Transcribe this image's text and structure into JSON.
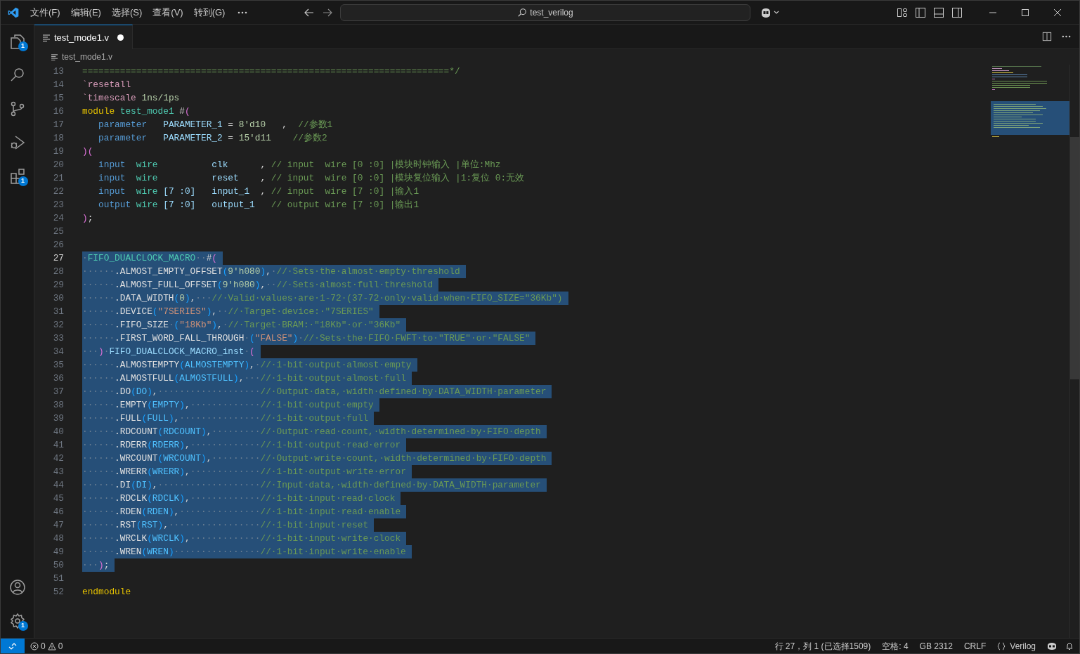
{
  "title_bar": {
    "menus": [
      "文件(F)",
      "编辑(E)",
      "选择(S)",
      "查看(V)",
      "转到(G)"
    ],
    "search": "test_verilog"
  },
  "activity_bar": {
    "top": [
      {
        "kind": "explorer",
        "badge": "1"
      },
      {
        "kind": "search"
      },
      {
        "kind": "source_control"
      },
      {
        "kind": "run_debug"
      },
      {
        "kind": "extensions",
        "badge": "1"
      }
    ],
    "bottom": [
      {
        "kind": "account"
      },
      {
        "kind": "settings",
        "badge": "1"
      }
    ]
  },
  "tab": {
    "label": "test_mode1.v",
    "selected": true,
    "modified": true
  },
  "breadcrumb": "test_mode1.v",
  "lines": [
    {
      "number": "13",
      "highlighted": false,
      "current": false,
      "tokens": [
        {
          "kind": "comment",
          "text": "====================================================================*/"
        }
      ]
    },
    {
      "number": "14",
      "highlighted": false,
      "current": false,
      "tokens": [
        {
          "kind": "directive",
          "text": "`resetall"
        }
      ]
    },
    {
      "number": "15",
      "highlighted": false,
      "current": false,
      "tokens": [
        {
          "kind": "directive",
          "text": "`timescale "
        },
        {
          "kind": "number",
          "text": "1ns/1ps"
        }
      ]
    },
    {
      "number": "16",
      "highlighted": false,
      "current": false,
      "tokens": [
        {
          "kind": "control",
          "text": "module "
        },
        {
          "kind": "module_name",
          "text": "test_mode1"
        },
        {
          "kind": "plain",
          "text": " #"
        },
        {
          "kind": "bracket_outer",
          "text": "("
        }
      ]
    },
    {
      "number": "17",
      "highlighted": false,
      "current": false,
      "tokens": [
        {
          "kind": "keyword",
          "text": "   parameter   "
        },
        {
          "kind": "ident",
          "text": "PARAMETER_1"
        },
        {
          "kind": "plain",
          "text": " = "
        },
        {
          "kind": "number",
          "text": "8'd10"
        },
        {
          "kind": "plain",
          "text": "   ,  "
        },
        {
          "kind": "comment",
          "text": "//参数1"
        }
      ]
    },
    {
      "number": "18",
      "highlighted": false,
      "current": false,
      "tokens": [
        {
          "kind": "keyword",
          "text": "   parameter   "
        },
        {
          "kind": "ident",
          "text": "PARAMETER_2"
        },
        {
          "kind": "plain",
          "text": " = "
        },
        {
          "kind": "number",
          "text": "15'd11    "
        },
        {
          "kind": "comment",
          "text": "//参数2"
        }
      ]
    },
    {
      "number": "19",
      "highlighted": false,
      "current": false,
      "tokens": [
        {
          "kind": "bracket_outer",
          "text": ")("
        }
      ]
    },
    {
      "number": "20",
      "highlighted": false,
      "current": false,
      "tokens": [
        {
          "kind": "keyword",
          "text": "   input  "
        },
        {
          "kind": "type",
          "text": "wire          "
        },
        {
          "kind": "ident",
          "text": "clk"
        },
        {
          "kind": "plain",
          "text": "      , "
        },
        {
          "kind": "comment",
          "text": "// input  wire [0 :0] |模块时钟输入 |单位:Mhz"
        }
      ]
    },
    {
      "number": "21",
      "highlighted": false,
      "current": false,
      "tokens": [
        {
          "kind": "keyword",
          "text": "   input  "
        },
        {
          "kind": "type",
          "text": "wire          "
        },
        {
          "kind": "ident",
          "text": "reset"
        },
        {
          "kind": "plain",
          "text": "    , "
        },
        {
          "kind": "comment",
          "text": "// input  wire [0 :0] |模块复位输入 |1:复位 0:无效"
        }
      ]
    },
    {
      "number": "22",
      "highlighted": false,
      "current": false,
      "tokens": [
        {
          "kind": "keyword",
          "text": "   input  "
        },
        {
          "kind": "type",
          "text": "wire "
        },
        {
          "kind": "ident",
          "text": "[7 :0]   "
        },
        {
          "kind": "ident",
          "text": "input_1"
        },
        {
          "kind": "plain",
          "text": "  , "
        },
        {
          "kind": "comment",
          "text": "// input  wire [7 :0] |输入1"
        }
      ]
    },
    {
      "number": "23",
      "highlighted": false,
      "current": false,
      "tokens": [
        {
          "kind": "keyword",
          "text": "   output "
        },
        {
          "kind": "type",
          "text": "wire "
        },
        {
          "kind": "ident",
          "text": "[7 :0]   "
        },
        {
          "kind": "ident",
          "text": "output_1   "
        },
        {
          "kind": "comment",
          "text": "// output wire [7 :0] |输出1"
        }
      ]
    },
    {
      "number": "24",
      "highlighted": false,
      "current": false,
      "tokens": [
        {
          "kind": "bracket_outer",
          "text": ")"
        },
        {
          "kind": "plain",
          "text": ";"
        }
      ]
    },
    {
      "number": "25",
      "highlighted": false,
      "current": false
    },
    {
      "number": "26",
      "highlighted": false,
      "current": false
    },
    {
      "number": "27",
      "highlighted": true,
      "current": true,
      "tokens": [
        {
          "kind": "ws",
          "text": "·"
        },
        {
          "kind": "module_name",
          "text": "FIFO_DUALCLOCK_MACRO"
        },
        {
          "kind": "ws",
          "text": "··"
        },
        {
          "kind": "plain",
          "text": "#"
        },
        {
          "kind": "bracket_outer",
          "text": "("
        }
      ]
    },
    {
      "number": "28",
      "highlighted": true,
      "current": false,
      "tokens": [
        {
          "kind": "ws",
          "text": "······"
        },
        {
          "kind": "port",
          "text": ".ALMOST_EMPTY_OFFSET"
        },
        {
          "kind": "bracket_inner",
          "text": "("
        },
        {
          "kind": "number",
          "text": "9'h080"
        },
        {
          "kind": "bracket_inner",
          "text": ")"
        },
        {
          "kind": "plain",
          "text": ","
        },
        {
          "kind": "ws",
          "text": "·"
        },
        {
          "kind": "comment",
          "text": "//·Sets·the·almost·empty·threshold"
        }
      ]
    },
    {
      "number": "29",
      "highlighted": true,
      "current": false,
      "tokens": [
        {
          "kind": "ws",
          "text": "······"
        },
        {
          "kind": "port",
          "text": ".ALMOST_FULL_OFFSET"
        },
        {
          "kind": "bracket_inner",
          "text": "("
        },
        {
          "kind": "number",
          "text": "9'h080"
        },
        {
          "kind": "bracket_inner",
          "text": ")"
        },
        {
          "kind": "plain",
          "text": ","
        },
        {
          "kind": "ws",
          "text": "··"
        },
        {
          "kind": "comment",
          "text": "//·Sets·almost·full·threshold"
        }
      ]
    },
    {
      "number": "30",
      "highlighted": true,
      "current": false,
      "tokens": [
        {
          "kind": "ws",
          "text": "······"
        },
        {
          "kind": "port",
          "text": ".DATA_WIDTH"
        },
        {
          "kind": "bracket_inner",
          "text": "("
        },
        {
          "kind": "number",
          "text": "0"
        },
        {
          "kind": "bracket_inner",
          "text": ")"
        },
        {
          "kind": "plain",
          "text": ","
        },
        {
          "kind": "ws",
          "text": "···"
        },
        {
          "kind": "comment",
          "text": "//·Valid·values·are·1-72·(37-72·only·valid·when·FIFO_SIZE=\"36Kb\")"
        }
      ]
    },
    {
      "number": "31",
      "highlighted": true,
      "current": false,
      "tokens": [
        {
          "kind": "ws",
          "text": "······"
        },
        {
          "kind": "port",
          "text": ".DEVICE"
        },
        {
          "kind": "bracket_inner",
          "text": "("
        },
        {
          "kind": "string",
          "text": "\"7SERIES\""
        },
        {
          "kind": "bracket_inner",
          "text": ")"
        },
        {
          "kind": "plain",
          "text": ","
        },
        {
          "kind": "ws",
          "text": "··"
        },
        {
          "kind": "comment",
          "text": "//·Target·device:·\"7SERIES\""
        }
      ]
    },
    {
      "number": "32",
      "highlighted": true,
      "current": false,
      "tokens": [
        {
          "kind": "ws",
          "text": "······"
        },
        {
          "kind": "port",
          "text": ".FIFO_SIZE"
        },
        {
          "kind": "ws",
          "text": "·"
        },
        {
          "kind": "bracket_inner",
          "text": "("
        },
        {
          "kind": "string",
          "text": "\"18Kb\""
        },
        {
          "kind": "bracket_inner",
          "text": ")"
        },
        {
          "kind": "plain",
          "text": ","
        },
        {
          "kind": "ws",
          "text": "·"
        },
        {
          "kind": "comment",
          "text": "//·Target·BRAM:·\"18Kb\"·or·\"36Kb\""
        }
      ]
    },
    {
      "number": "33",
      "highlighted": true,
      "current": false,
      "tokens": [
        {
          "kind": "ws",
          "text": "······"
        },
        {
          "kind": "port",
          "text": ".FIRST_WORD_FALL_THROUGH"
        },
        {
          "kind": "ws",
          "text": "·"
        },
        {
          "kind": "bracket_inner",
          "text": "("
        },
        {
          "kind": "string",
          "text": "\"FALSE\""
        },
        {
          "kind": "bracket_inner",
          "text": ")"
        },
        {
          "kind": "ws",
          "text": "·"
        },
        {
          "kind": "comment",
          "text": "//·Sets·the·FIFO·FWFT·to·\"TRUE\"·or·\"FALSE\""
        }
      ]
    },
    {
      "number": "34",
      "highlighted": true,
      "current": false,
      "tokens": [
        {
          "kind": "ws",
          "text": "···"
        },
        {
          "kind": "bracket_outer",
          "text": ")"
        },
        {
          "kind": "ws",
          "text": "·"
        },
        {
          "kind": "ident",
          "text": "FIFO_DUALCLOCK_MACRO_inst"
        },
        {
          "kind": "ws",
          "text": "·"
        },
        {
          "kind": "bracket_outer",
          "text": "("
        }
      ]
    },
    {
      "number": "35",
      "highlighted": true,
      "current": false,
      "tokens": [
        {
          "kind": "ws",
          "text": "······"
        },
        {
          "kind": "port",
          "text": ".ALMOSTEMPTY"
        },
        {
          "kind": "bracket_inner",
          "text": "("
        },
        {
          "kind": "signal",
          "text": "ALMOSTEMPTY"
        },
        {
          "kind": "bracket_inner",
          "text": ")"
        },
        {
          "kind": "plain",
          "text": ","
        },
        {
          "kind": "ws",
          "text": "·"
        },
        {
          "kind": "comment",
          "text": "//·1-bit·output·almost·empty"
        }
      ]
    },
    {
      "number": "36",
      "highlighted": true,
      "current": false,
      "tokens": [
        {
          "kind": "ws",
          "text": "······"
        },
        {
          "kind": "port",
          "text": ".ALMOSTFULL"
        },
        {
          "kind": "bracket_inner",
          "text": "("
        },
        {
          "kind": "signal",
          "text": "ALMOSTFULL"
        },
        {
          "kind": "bracket_inner",
          "text": ")"
        },
        {
          "kind": "plain",
          "text": ","
        },
        {
          "kind": "ws",
          "text": "···"
        },
        {
          "kind": "comment",
          "text": "//·1-bit·output·almost·full"
        }
      ]
    },
    {
      "number": "37",
      "highlighted": true,
      "current": false,
      "tokens": [
        {
          "kind": "ws",
          "text": "······"
        },
        {
          "kind": "port",
          "text": ".DO"
        },
        {
          "kind": "bracket_inner",
          "text": "("
        },
        {
          "kind": "signal",
          "text": "DO"
        },
        {
          "kind": "bracket_inner",
          "text": ")"
        },
        {
          "kind": "plain",
          "text": ","
        },
        {
          "kind": "ws",
          "text": "···················"
        },
        {
          "kind": "comment",
          "text": "//·Output·data,·width·defined·by·DATA_WIDTH·parameter"
        }
      ]
    },
    {
      "number": "38",
      "highlighted": true,
      "current": false,
      "tokens": [
        {
          "kind": "ws",
          "text": "······"
        },
        {
          "kind": "port",
          "text": ".EMPTY"
        },
        {
          "kind": "bracket_inner",
          "text": "("
        },
        {
          "kind": "signal",
          "text": "EMPTY"
        },
        {
          "kind": "bracket_inner",
          "text": ")"
        },
        {
          "kind": "plain",
          "text": ","
        },
        {
          "kind": "ws",
          "text": "·············"
        },
        {
          "kind": "comment",
          "text": "//·1-bit·output·empty"
        }
      ]
    },
    {
      "number": "39",
      "highlighted": true,
      "current": false,
      "tokens": [
        {
          "kind": "ws",
          "text": "······"
        },
        {
          "kind": "port",
          "text": ".FULL"
        },
        {
          "kind": "bracket_inner",
          "text": "("
        },
        {
          "kind": "signal",
          "text": "FULL"
        },
        {
          "kind": "bracket_inner",
          "text": ")"
        },
        {
          "kind": "plain",
          "text": ","
        },
        {
          "kind": "ws",
          "text": "···············"
        },
        {
          "kind": "comment",
          "text": "//·1-bit·output·full"
        }
      ]
    },
    {
      "number": "40",
      "highlighted": true,
      "current": false,
      "tokens": [
        {
          "kind": "ws",
          "text": "······"
        },
        {
          "kind": "port",
          "text": ".RDCOUNT"
        },
        {
          "kind": "bracket_inner",
          "text": "("
        },
        {
          "kind": "signal",
          "text": "RDCOUNT"
        },
        {
          "kind": "bracket_inner",
          "text": ")"
        },
        {
          "kind": "plain",
          "text": ","
        },
        {
          "kind": "ws",
          "text": "·········"
        },
        {
          "kind": "comment",
          "text": "//·Output·read·count,·width·determined·by·FIFO·depth"
        }
      ]
    },
    {
      "number": "41",
      "highlighted": true,
      "current": false,
      "tokens": [
        {
          "kind": "ws",
          "text": "······"
        },
        {
          "kind": "port",
          "text": ".RDERR"
        },
        {
          "kind": "bracket_inner",
          "text": "("
        },
        {
          "kind": "signal",
          "text": "RDERR"
        },
        {
          "kind": "bracket_inner",
          "text": ")"
        },
        {
          "kind": "plain",
          "text": ","
        },
        {
          "kind": "ws",
          "text": "·············"
        },
        {
          "kind": "comment",
          "text": "//·1-bit·output·read·error"
        }
      ]
    },
    {
      "number": "42",
      "highlighted": true,
      "current": false,
      "tokens": [
        {
          "kind": "ws",
          "text": "······"
        },
        {
          "kind": "port",
          "text": ".WRCOUNT"
        },
        {
          "kind": "bracket_inner",
          "text": "("
        },
        {
          "kind": "signal",
          "text": "WRCOUNT"
        },
        {
          "kind": "bracket_inner",
          "text": ")"
        },
        {
          "kind": "plain",
          "text": ","
        },
        {
          "kind": "ws",
          "text": "·········"
        },
        {
          "kind": "comment",
          "text": "//·Output·write·count,·width·determined·by·FIFO·depth"
        }
      ]
    },
    {
      "number": "43",
      "highlighted": true,
      "current": false,
      "tokens": [
        {
          "kind": "ws",
          "text": "······"
        },
        {
          "kind": "port",
          "text": ".WRERR"
        },
        {
          "kind": "bracket_inner",
          "text": "("
        },
        {
          "kind": "signal",
          "text": "WRERR"
        },
        {
          "kind": "bracket_inner",
          "text": ")"
        },
        {
          "kind": "plain",
          "text": ","
        },
        {
          "kind": "ws",
          "text": "·············"
        },
        {
          "kind": "comment",
          "text": "//·1-bit·output·write·error"
        }
      ]
    },
    {
      "number": "44",
      "highlighted": true,
      "current": false,
      "tokens": [
        {
          "kind": "ws",
          "text": "······"
        },
        {
          "kind": "port",
          "text": ".DI"
        },
        {
          "kind": "bracket_inner",
          "text": "("
        },
        {
          "kind": "signal",
          "text": "DI"
        },
        {
          "kind": "bracket_inner",
          "text": ")"
        },
        {
          "kind": "plain",
          "text": ","
        },
        {
          "kind": "ws",
          "text": "···················"
        },
        {
          "kind": "comment",
          "text": "//·Input·data,·width·defined·by·DATA_WIDTH·parameter"
        }
      ]
    },
    {
      "number": "45",
      "highlighted": true,
      "current": false,
      "tokens": [
        {
          "kind": "ws",
          "text": "······"
        },
        {
          "kind": "port",
          "text": ".RDCLK"
        },
        {
          "kind": "bracket_inner",
          "text": "("
        },
        {
          "kind": "signal",
          "text": "RDCLK"
        },
        {
          "kind": "bracket_inner",
          "text": ")"
        },
        {
          "kind": "plain",
          "text": ","
        },
        {
          "kind": "ws",
          "text": "·············"
        },
        {
          "kind": "comment",
          "text": "//·1-bit·input·read·clock"
        }
      ]
    },
    {
      "number": "46",
      "highlighted": true,
      "current": false,
      "tokens": [
        {
          "kind": "ws",
          "text": "······"
        },
        {
          "kind": "port",
          "text": ".RDEN"
        },
        {
          "kind": "bracket_inner",
          "text": "("
        },
        {
          "kind": "signal",
          "text": "RDEN"
        },
        {
          "kind": "bracket_inner",
          "text": ")"
        },
        {
          "kind": "plain",
          "text": ","
        },
        {
          "kind": "ws",
          "text": "···············"
        },
        {
          "kind": "comment",
          "text": "//·1-bit·input·read·enable"
        }
      ]
    },
    {
      "number": "47",
      "highlighted": true,
      "current": false,
      "tokens": [
        {
          "kind": "ws",
          "text": "······"
        },
        {
          "kind": "port",
          "text": ".RST"
        },
        {
          "kind": "bracket_inner",
          "text": "("
        },
        {
          "kind": "signal",
          "text": "RST"
        },
        {
          "kind": "bracket_inner",
          "text": ")"
        },
        {
          "kind": "plain",
          "text": ","
        },
        {
          "kind": "ws",
          "text": "·················"
        },
        {
          "kind": "comment",
          "text": "//·1-bit·input·reset"
        }
      ]
    },
    {
      "number": "48",
      "highlighted": true,
      "current": false,
      "tokens": [
        {
          "kind": "ws",
          "text": "······"
        },
        {
          "kind": "port",
          "text": ".WRCLK"
        },
        {
          "kind": "bracket_inner",
          "text": "("
        },
        {
          "kind": "signal",
          "text": "WRCLK"
        },
        {
          "kind": "bracket_inner",
          "text": ")"
        },
        {
          "kind": "plain",
          "text": ","
        },
        {
          "kind": "ws",
          "text": "·············"
        },
        {
          "kind": "comment",
          "text": "//·1-bit·input·write·clock"
        }
      ]
    },
    {
      "number": "49",
      "highlighted": true,
      "current": false,
      "tokens": [
        {
          "kind": "ws",
          "text": "······"
        },
        {
          "kind": "port",
          "text": ".WREN"
        },
        {
          "kind": "bracket_inner",
          "text": "("
        },
        {
          "kind": "signal",
          "text": "WREN"
        },
        {
          "kind": "bracket_inner",
          "text": ")"
        },
        {
          "kind": "ws",
          "text": "················"
        },
        {
          "kind": "comment",
          "text": "//·1-bit·input·write·enable"
        }
      ]
    },
    {
      "number": "50",
      "highlighted": true,
      "current": false,
      "tokens": [
        {
          "kind": "ws",
          "text": "···"
        },
        {
          "kind": "bracket_outer",
          "text": ")"
        },
        {
          "kind": "plain",
          "text": ";"
        }
      ]
    },
    {
      "number": "51",
      "highlighted": false,
      "current": false
    },
    {
      "number": "52",
      "highlighted": false,
      "current": false,
      "tokens": [
        {
          "kind": "control",
          "text": "endmodule"
        }
      ]
    }
  ],
  "status_bar": {
    "errors": "0",
    "warnings": "0",
    "items": [
      "行 27，列 1 (已选择1509)",
      "空格: 4",
      "GB 2312",
      "CRLF"
    ],
    "language": "Verilog"
  }
}
